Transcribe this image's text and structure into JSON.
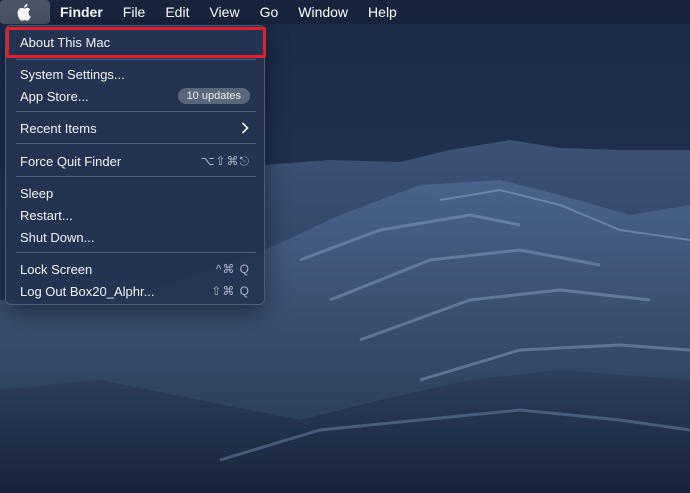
{
  "menubar": {
    "apple_icon": "apple-logo-icon",
    "items": [
      "Finder",
      "File",
      "Edit",
      "View",
      "Go",
      "Window",
      "Help"
    ]
  },
  "apple_menu": {
    "about": "About This Mac",
    "system_settings": "System Settings...",
    "app_store": "App Store...",
    "app_store_badge": "10 updates",
    "recent_items": "Recent Items",
    "recent_items_icon": "chevron-right-icon",
    "force_quit": "Force Quit Finder",
    "force_quit_shortcut": "⌥⇧⌘⎋",
    "sleep": "Sleep",
    "restart": "Restart...",
    "shut_down": "Shut Down...",
    "lock_screen": "Lock Screen",
    "lock_screen_shortcut": "^⌘ Q",
    "log_out": "Log Out Box20_Alphr...",
    "log_out_shortcut": "⇧⌘ Q"
  },
  "colors": {
    "highlight_border": "#e0202a",
    "menu_bg": "#243452",
    "desktop_sky": "#1b2a48"
  }
}
